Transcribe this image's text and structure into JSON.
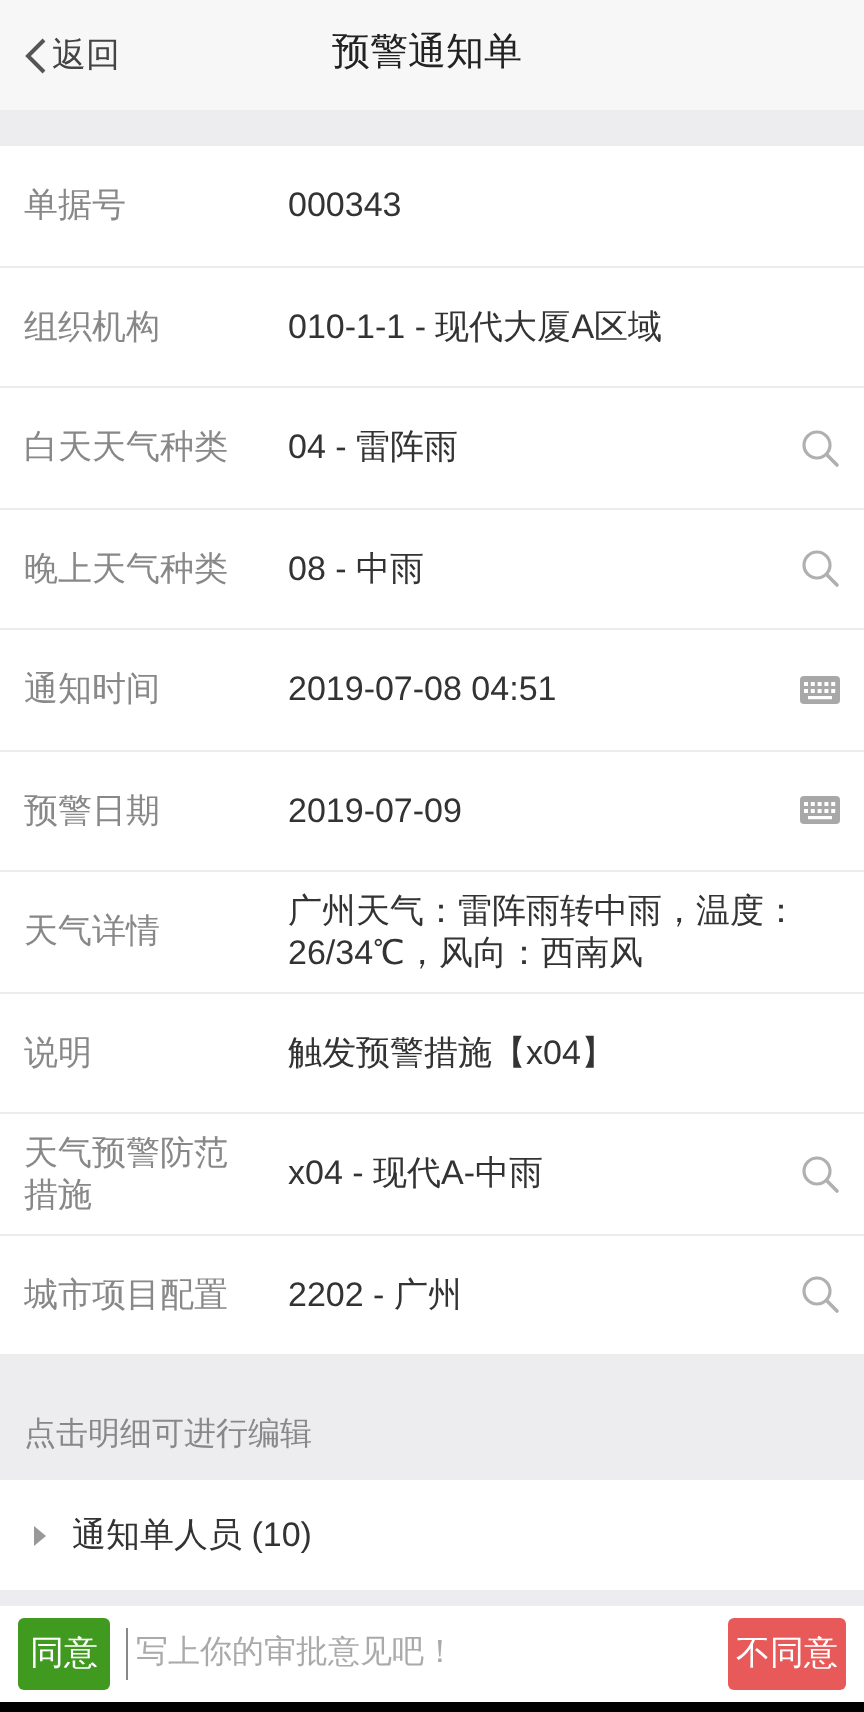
{
  "header": {
    "back": "返回",
    "title": "预警通知单"
  },
  "fields": [
    {
      "label": "单据号",
      "value": "000343",
      "kind": "plain"
    },
    {
      "label": "组织机构",
      "value": "010-1-1 - 现代大厦A区域",
      "kind": "plain"
    },
    {
      "label": "白天天气种类",
      "value": "04 - 雷阵雨",
      "kind": "lookup"
    },
    {
      "label": "晚上天气种类",
      "value": "08 - 中雨",
      "kind": "lookup"
    },
    {
      "label": "通知时间",
      "value": "2019-07-08 04:51",
      "kind": "date"
    },
    {
      "label": "预警日期",
      "value": "2019-07-09",
      "kind": "date"
    },
    {
      "label": "天气详情",
      "value": "广州天气：雷阵雨转中雨，温度：26/34℃，风向：西南风",
      "kind": "plain"
    },
    {
      "label": "说明",
      "value": "触发预警措施【x04】",
      "kind": "plain"
    },
    {
      "label": "天气预警防范措施",
      "value": "x04 - 现代A-中雨",
      "kind": "lookup"
    },
    {
      "label": "城市项目配置",
      "value": "2202 - 广州",
      "kind": "lookup"
    }
  ],
  "hint": "点击明细可进行编辑",
  "detail": {
    "label": "通知单人员 (10)",
    "expanded": false
  },
  "footer": {
    "agree": "同意",
    "placeholder": "写上你的审批意见吧！",
    "disagree": "不同意"
  }
}
